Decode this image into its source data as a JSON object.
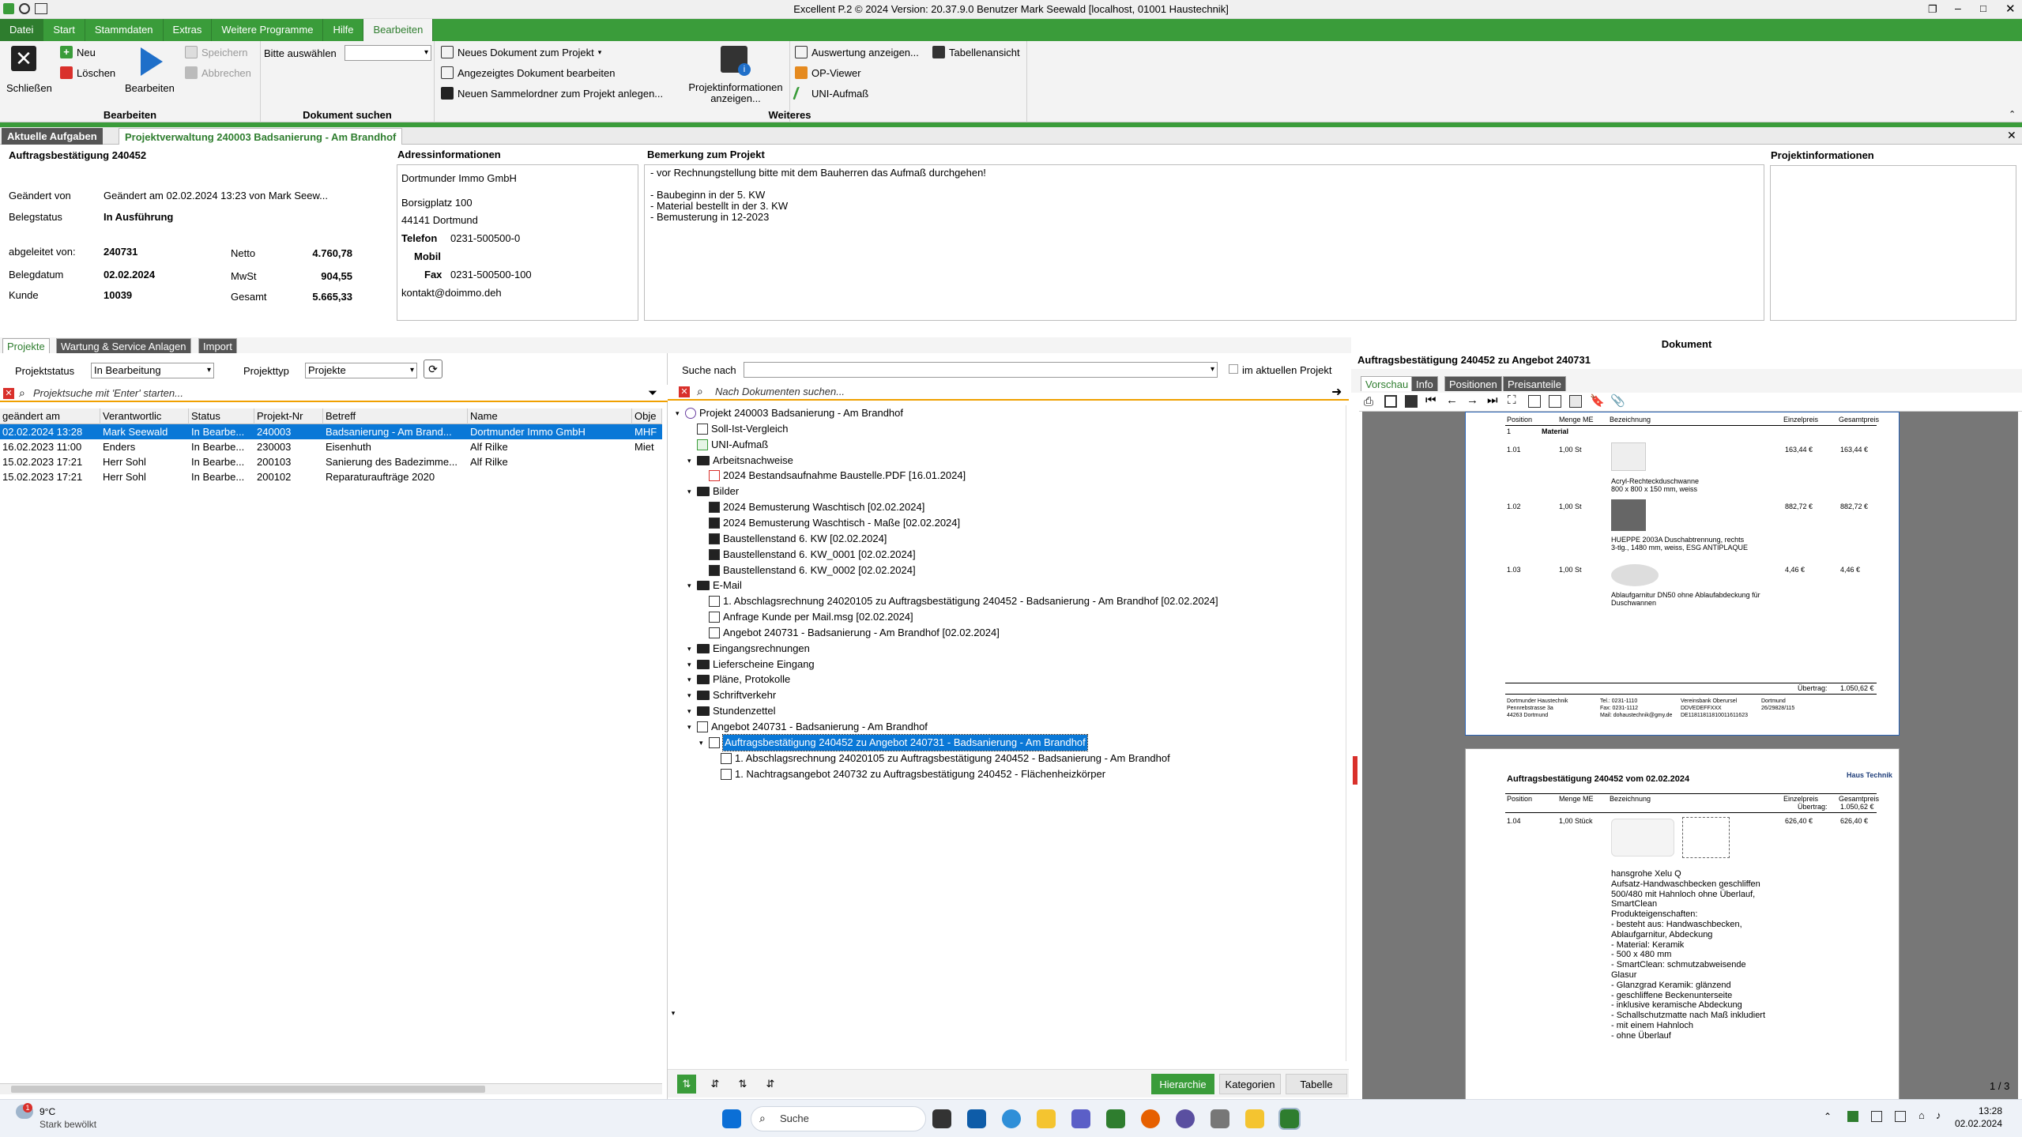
{
  "window": {
    "title": "Excellent P.2 © 2024 Version: 20.37.9.0 Benutzer Mark Seewald [localhost, 01001 Haustechnik]"
  },
  "menu": [
    "Datei",
    "Start",
    "Stammdaten",
    "Extras",
    "Weitere Programme",
    "Hilfe",
    "Bearbeiten"
  ],
  "ribbon": {
    "close": "Schließen",
    "new": "Neu",
    "delete": "Löschen",
    "edit": "Bearbeiten",
    "save": "Speichern",
    "cancel": "Abbrechen",
    "group_edit": "Bearbeiten",
    "select_label": "Bitte auswählen",
    "group_docsearch": "Dokument suchen",
    "new_doc": "Neues Dokument zum Projekt",
    "edit_doc": "Angezeigtes Dokument bearbeiten",
    "new_folder": "Neuen Sammelordner zum Projekt anlegen...",
    "proj_info": "Projektinformationen anzeigen...",
    "show_eval": "Auswertung anzeigen...",
    "table_view": "Tabellenansicht",
    "op_viewer": "OP-Viewer",
    "uni": "UNI-Aufmaß",
    "group_more": "Weiteres"
  },
  "tabs": {
    "tasks": "Aktuelle Aufgaben",
    "project": "Projektverwaltung 240003 Badsanierung - Am Brandhof"
  },
  "doc": {
    "heading": "Auftragsbestätigung 240452",
    "changed_label": "Geändert von",
    "changed_value": "Geändert am 02.02.2024 13:23 von Mark Seew...",
    "status_label": "Belegstatus",
    "status_value": "In Ausführung",
    "derived_label": "abgeleitet von:",
    "derived_value": "240731",
    "date_label": "Belegdatum",
    "date_value": "02.02.2024",
    "customer_label": "Kunde",
    "customer_value": "10039",
    "net_label": "Netto",
    "net_value": "4.760,78",
    "vat_label": "MwSt",
    "vat_value": "904,55",
    "total_label": "Gesamt",
    "total_value": "5.665,33"
  },
  "address": {
    "heading": "Adressinformationen",
    "company": "Dortmunder Immo GmbH",
    "street": "Borsigplatz 100",
    "city": "44141 Dortmund",
    "phone_label": "Telefon",
    "phone": "0231-500500-0",
    "mobile_label": "Mobil",
    "fax_label": "Fax",
    "fax": "0231-500500-100",
    "email": "kontakt@doimmo.deh"
  },
  "remark": {
    "heading": "Bemerkung zum Projekt",
    "lines": [
      "- vor Rechnungstellung bitte mit dem Bauherren das Aufmaß durchgehen!",
      "",
      "- Baubeginn in der 5. KW",
      "- Material bestellt in der 3. KW",
      "- Bemusterung in 12-2023"
    ]
  },
  "projinfo": {
    "heading": "Projektinformationen"
  },
  "lowtabs": [
    "Projekte",
    "Wartung & Service Anlagen",
    "Import"
  ],
  "filters": {
    "status_label": "Projektstatus",
    "status_value": "In Bearbeitung",
    "type_label": "Projekttyp",
    "type_value": "Projekte",
    "search_placeholder": "Projektsuche mit 'Enter' starten...",
    "docsearch_label": "Suche nach",
    "current_project": "im aktuellen Projekt",
    "docsearch_placeholder": "Nach Dokumenten suchen..."
  },
  "grid": {
    "columns": [
      "geändert am",
      "Verantwortlic",
      "Status",
      "Projekt-Nr",
      "Betreff",
      "Name",
      "Obje"
    ],
    "rows": [
      [
        "02.02.2024 13:28",
        "Mark Seewald",
        "In Bearbe...",
        "240003",
        "Badsanierung - Am Brand...",
        "Dortmunder Immo GmbH",
        "MHF"
      ],
      [
        "16.02.2023 11:00",
        "Enders",
        "In Bearbe...",
        "230003",
        "Eisenhuth",
        "Alf Rilke",
        "Miet"
      ],
      [
        "15.02.2023 17:21",
        "Herr Sohl",
        "In Bearbe...",
        "200103",
        "Sanierung des Badezimme...",
        "Alf Rilke",
        ""
      ],
      [
        "15.02.2023 17:21",
        "Herr Sohl",
        "In Bearbe...",
        "200102",
        "Reparaturaufträge 2020",
        "",
        ""
      ]
    ]
  },
  "tree": [
    {
      "text": "Projekt 240003 Badsanierung - Am Brandhof",
      "level": 0,
      "icon": "project-icon"
    },
    {
      "text": "Soll-Ist-Vergleich",
      "level": 1,
      "icon": "table-icon"
    },
    {
      "text": "UNI-Aufmaß",
      "level": 1,
      "icon": "uni-icon"
    },
    {
      "text": "Arbeitsnachweise",
      "level": 1,
      "icon": "folder-icon"
    },
    {
      "text": "2024 Bestandsaufnahme Baustelle.PDF [16.01.2024]",
      "level": 2,
      "icon": "pdf-icon"
    },
    {
      "text": "Bilder",
      "level": 1,
      "icon": "folder-icon"
    },
    {
      "text": "2024 Bemusterung Waschtisch [02.02.2024]",
      "level": 2,
      "icon": "image-icon"
    },
    {
      "text": "2024 Bemusterung Waschtisch - Maße [02.02.2024]",
      "level": 2,
      "icon": "image-icon"
    },
    {
      "text": "Baustellenstand 6. KW [02.02.2024]",
      "level": 2,
      "icon": "image-icon"
    },
    {
      "text": "Baustellenstand 6. KW_0001 [02.02.2024]",
      "level": 2,
      "icon": "image-icon"
    },
    {
      "text": "Baustellenstand 6. KW_0002 [02.02.2024]",
      "level": 2,
      "icon": "image-icon"
    },
    {
      "text": "E-Mail",
      "level": 1,
      "icon": "folder-icon"
    },
    {
      "text": "1. Abschlagsrechnung 24020105 zu Auftragsbestätigung 240452 - Badsanierung - Am Brandhof [02.02.2024]",
      "level": 2,
      "icon": "mail-icon"
    },
    {
      "text": "Anfrage Kunde per Mail.msg [02.02.2024]",
      "level": 2,
      "icon": "mail-icon"
    },
    {
      "text": "Angebot 240731 - Badsanierung - Am Brandhof [02.02.2024]",
      "level": 2,
      "icon": "mail-icon"
    },
    {
      "text": "Eingangsrechnungen",
      "level": 1,
      "icon": "folder-icon"
    },
    {
      "text": "Lieferscheine Eingang",
      "level": 1,
      "icon": "folder-icon"
    },
    {
      "text": "Pläne, Protokolle",
      "level": 1,
      "icon": "folder-icon"
    },
    {
      "text": "Schriftverkehr",
      "level": 1,
      "icon": "folder-icon"
    },
    {
      "text": "Stundenzettel",
      "level": 1,
      "icon": "folder-icon"
    },
    {
      "text": "Angebot 240731 - Badsanierung - Am Brandhof",
      "level": 1,
      "icon": "doc-icon"
    },
    {
      "text": "Auftragsbestätigung 240452 zu Angebot 240731 - Badsanierung - Am Brandhof",
      "level": 2,
      "icon": "doc-icon"
    },
    {
      "text": "1. Abschlagsrechnung 24020105 zu Auftragsbestätigung 240452 - Badsanierung - Am Brandhof",
      "level": 3,
      "icon": "doc-icon"
    },
    {
      "text": "1. Nachtragsangebot 240732 zu Auftragsbestätigung 240452 - Flächenheizkörper",
      "level": 3,
      "icon": "doc-icon"
    }
  ],
  "viewbtns": {
    "hierarchy": "Hierarchie",
    "categories": "Kategorien",
    "table": "Tabelle"
  },
  "docpanel": {
    "heading": "Dokument",
    "subtitle": "Auftragsbestätigung 240452 zu Angebot 240731",
    "tabs": [
      "Vorschau",
      "Info",
      "Positionen",
      "Preisanteile"
    ],
    "pager": "1 / 3"
  },
  "preview": {
    "hdr": [
      "Position",
      "Menge ME",
      "Bezeichnung",
      "Einzelpreis",
      "Gesamtpreis"
    ],
    "group": "Material",
    "items": [
      {
        "pos": "1.01",
        "qty": "1,00 St",
        "desc": "Acryl-Rechteckduschwanne",
        "desc2": "800 x 800 x 150 mm, weiss",
        "ep": "163,44 €",
        "gp": "163,44 €"
      },
      {
        "pos": "1.02",
        "qty": "1,00 St",
        "desc": "HUEPPE 2003A Duschabtrennung, rechts",
        "desc2": "3-tlg., 1480 mm, weiss, ESG ANTIPLAQUE",
        "ep": "882,72 €",
        "gp": "882,72 €"
      },
      {
        "pos": "1.03",
        "qty": "1,00 St",
        "desc": "Ablaufgarnitur DN50 ohne Ablaufabdeckung für",
        "desc2": "Duschwannen",
        "ep": "4,46 €",
        "gp": "4,46 €"
      }
    ],
    "carry_label": "Übertrag:",
    "carry_value": "1.050,62 €",
    "footer": [
      "Dortmunder Haustechnik",
      "Tel.: 0231-1110",
      "Vereinsbank Oberursel",
      "Dortmund",
      "Pennrebstrasse 3a",
      "Fax: 0231-1112",
      "DDVEDEFFXXX",
      "26/29828/115",
      "44263 Dortmund",
      "Mail: dohaustechnik@gmy.de",
      "DE11811811810011611623"
    ],
    "page2_title": "Auftragsbestätigung 240452  vom 02.02.2024",
    "logo": "Haus Technik",
    "item4": {
      "pos": "1.04",
      "qty": "1,00 Stück",
      "ep": "626,40 €",
      "gp": "626,40 €"
    },
    "desc4": [
      "hansgrohe Xelu Q",
      "Aufsatz-Handwaschbecken geschliffen",
      "500/480 mit Hahnloch ohne Überlauf,",
      "SmartClean",
      "Produkteigenschaften:",
      "- besteht aus: Handwaschbecken,",
      "Ablaufgarnitur, Abdeckung",
      "- Material: Keramik",
      "- 500 x 480 mm",
      "- SmartClean: schmutzabweisende",
      "Glasur",
      "- Glanzgrad Keramik: glänzend",
      "- geschliffene Beckenunterseite",
      "- inklusive keramische Abdeckung",
      "- Schallschutzmatte nach Maß inkludiert",
      "- mit einem Hahnloch",
      "- ohne Überlauf"
    ]
  },
  "taskbar": {
    "temp": "9°C",
    "weather": "Stark bewölkt",
    "search": "Suche",
    "time": "13:28",
    "date": "02.02.2024"
  }
}
